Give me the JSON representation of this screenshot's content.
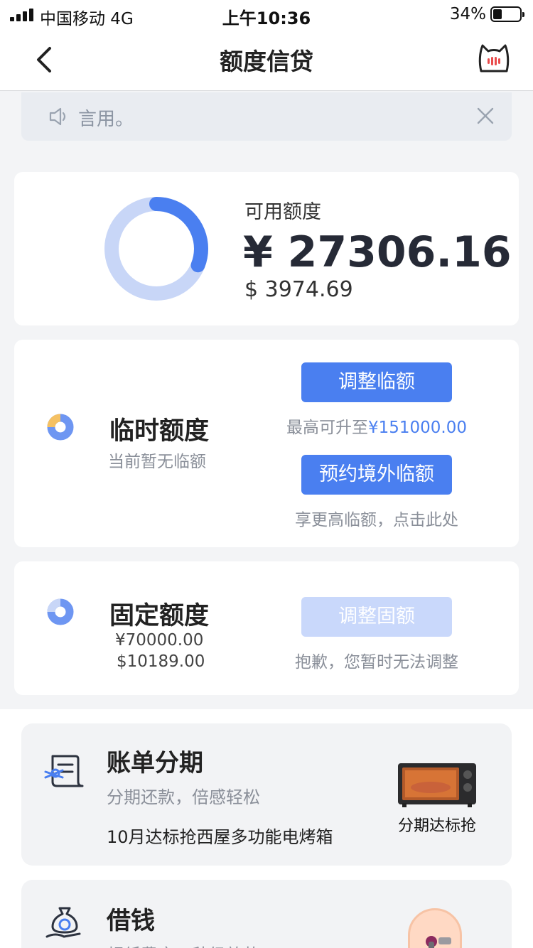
{
  "status_bar": {
    "carrier": "中国移动  4G",
    "time": "上午10:36",
    "battery_pct": "34%",
    "battery_level": 0.34
  },
  "nav": {
    "title": "额度信贷"
  },
  "notice": {
    "text": "言用。"
  },
  "available": {
    "label": "可用额度",
    "cny": "¥ 27306.16",
    "usd": "$ 3974.69",
    "used_ratio": 0.31
  },
  "temporary": {
    "title": "临时额度",
    "subtitle": "当前暂无临额",
    "adjust_button": "调整临额",
    "max_prefix": "最高可升至",
    "max_value": "¥151000.00",
    "overseas_button": "预约境外临额",
    "overseas_note": "享更高临额，点击此处"
  },
  "fixed": {
    "title": "固定额度",
    "cny": "¥70000.00",
    "usd": "$10189.00",
    "adjust_button": "调整固额",
    "note": "抱歉，您暂时无法调整"
  },
  "promos": [
    {
      "title": "账单分期",
      "subtitle": "分期还款，倍感轻松",
      "line": "10月达标抢西屋多功能电烤箱",
      "caption": "分期达标抢"
    },
    {
      "title": "借钱",
      "subtitle": "超低费率，秒级放款"
    }
  ],
  "colors": {
    "accent": "#4a7ff0",
    "accent_light": "#c9d8fb",
    "ring_light": "#c8d6f7",
    "mini_orange": "#f5c163"
  },
  "icons": [
    "back-chevron-icon",
    "cat-mascot-icon",
    "speaker-icon",
    "close-icon",
    "bill-installment-icon",
    "loan-money-icon"
  ]
}
